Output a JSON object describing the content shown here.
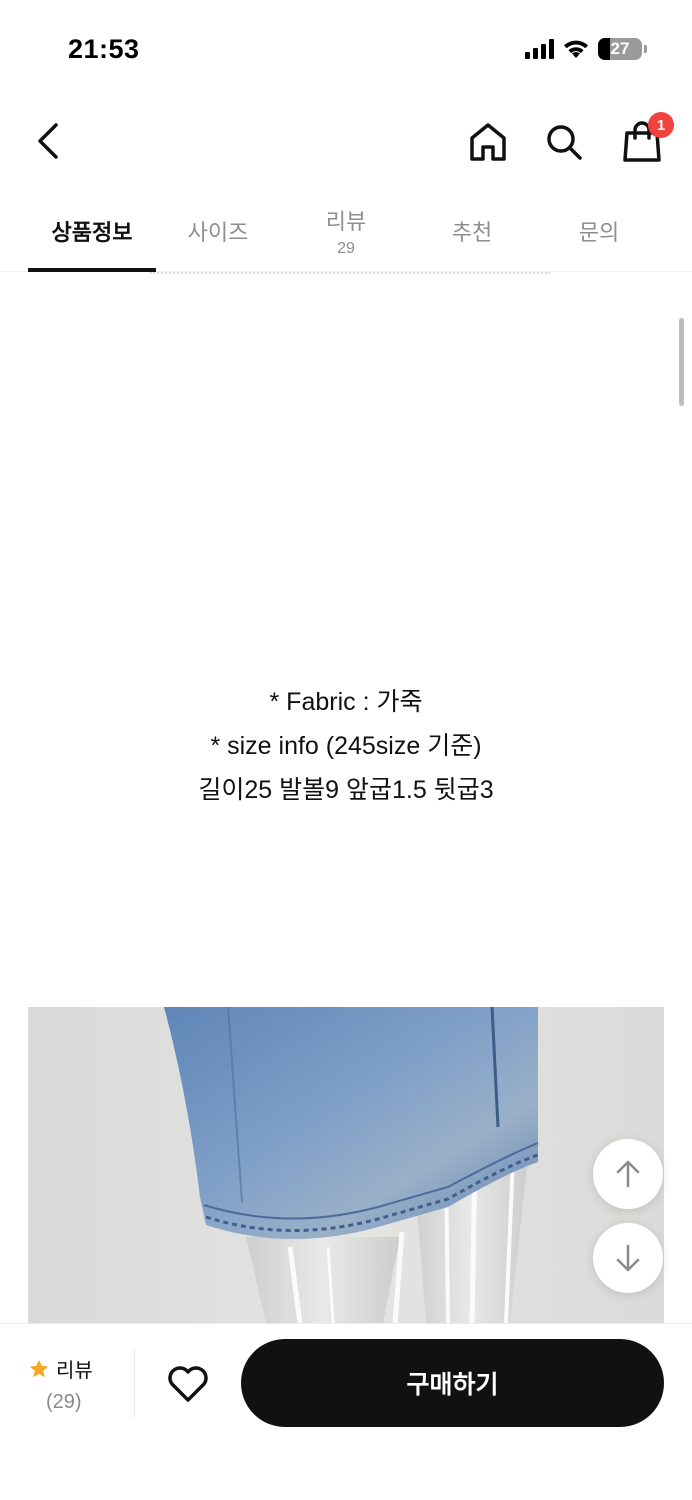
{
  "status_bar": {
    "time": "21:53",
    "battery_level": "27"
  },
  "header": {
    "back_icon": "chevron-left-icon",
    "home_icon": "home-icon",
    "search_icon": "search-icon",
    "cart_icon": "shopping-bag-icon",
    "cart_badge": "1"
  },
  "tabs": [
    {
      "label": "상품정보",
      "active": true
    },
    {
      "label": "사이즈"
    },
    {
      "label": "리뷰",
      "count": "29"
    },
    {
      "label": "추천"
    },
    {
      "label": "문의"
    }
  ],
  "content": {
    "lines": [
      "* Fabric : 가죽",
      "* size info (245size 기준)",
      "길이25 발볼9 앞굽1.5 뒷굽3"
    ]
  },
  "floating": {
    "up_icon": "arrow-up-icon",
    "down_icon": "arrow-down-icon"
  },
  "bottom_bar": {
    "review_label": "리뷰",
    "review_count": "(29)",
    "star_color": "#f5a623",
    "wish_icon": "heart-icon",
    "buy_label": "구매하기"
  }
}
